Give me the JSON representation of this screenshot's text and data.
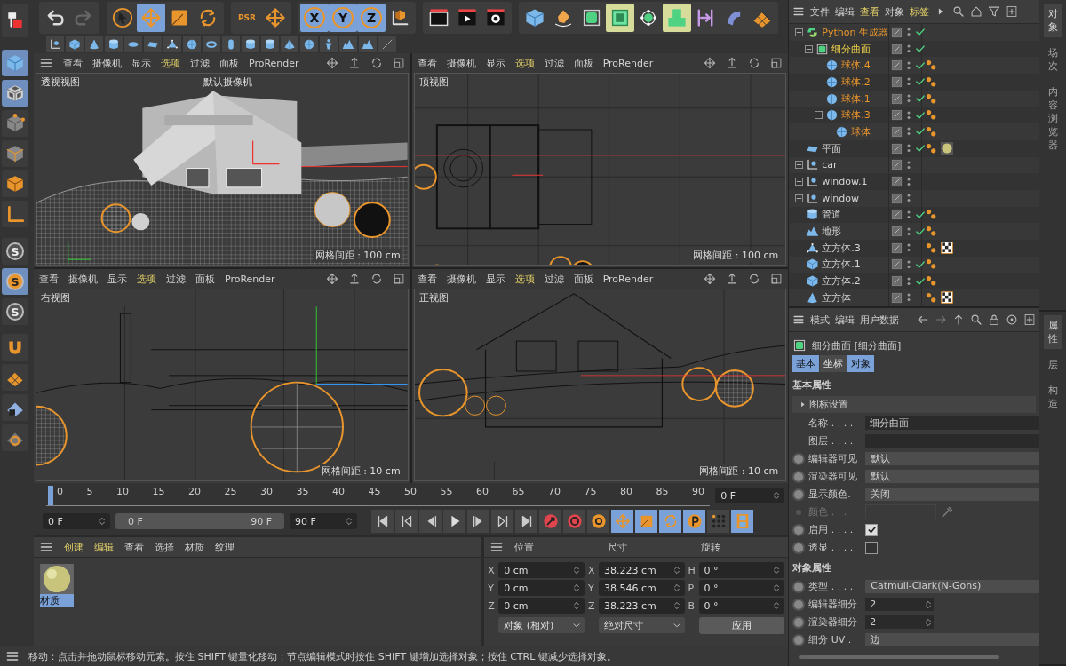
{
  "left_toolbar": [
    {
      "kind": "objects-mode",
      "selected": false
    },
    {
      "kind": "cube",
      "selected": true
    },
    {
      "kind": "checker-cube",
      "selected": true
    },
    {
      "kind": "point-cube",
      "selected": false
    },
    {
      "kind": "edge-cube",
      "selected": false
    },
    {
      "kind": "poly-cube",
      "selected": false
    },
    {
      "kind": "axis",
      "selected": false
    },
    {
      "kind": "letter",
      "label": "S",
      "selected": false
    },
    {
      "kind": "letter",
      "label": "S",
      "selected": true
    },
    {
      "kind": "letter",
      "label": "S",
      "selected": false
    },
    {
      "kind": "magnet",
      "selected": false
    },
    {
      "kind": "floor-grid",
      "selected": false
    },
    {
      "kind": "lock-grid",
      "selected": false
    },
    {
      "kind": "refresh-grid",
      "selected": false
    }
  ],
  "main_toolbar": [
    {
      "tools": [
        {
          "kind": "undo",
          "selected": false
        },
        {
          "kind": "redo",
          "selected": false
        }
      ]
    },
    {
      "tools": [
        {
          "kind": "select",
          "selected": false
        },
        {
          "kind": "move",
          "selected": true
        },
        {
          "kind": "scale",
          "selected": false
        },
        {
          "kind": "rotate",
          "selected": false
        }
      ]
    },
    {
      "tools": [
        {
          "kind": "psr",
          "label": "PSR",
          "selected": false
        },
        {
          "kind": "move",
          "selected": false
        }
      ]
    },
    {
      "tools": [
        {
          "kind": "axis-letter",
          "label": "X",
          "selected": true
        },
        {
          "kind": "axis-letter",
          "label": "Y",
          "selected": true
        },
        {
          "kind": "axis-letter",
          "label": "Z",
          "selected": true
        },
        {
          "kind": "coord",
          "selected": false
        }
      ]
    },
    {
      "tools": [
        {
          "kind": "clapper",
          "selected": false
        },
        {
          "kind": "render",
          "selected": false
        },
        {
          "kind": "render-settings",
          "selected": false
        }
      ]
    },
    {
      "tools": [
        {
          "kind": "cube",
          "selected": false
        },
        {
          "kind": "pen",
          "selected": false
        },
        {
          "kind": "subdiv",
          "selected": false
        },
        {
          "kind": "extrude",
          "selected": false
        },
        {
          "kind": "net",
          "selected": false
        },
        {
          "kind": "cubes",
          "selected": false
        },
        {
          "kind": "symmetry",
          "selected": false
        },
        {
          "kind": "bend",
          "selected": false
        },
        {
          "kind": "floor-grid",
          "selected": false
        }
      ]
    }
  ],
  "primitives": [
    {
      "kind": "null"
    },
    {
      "kind": "cube"
    },
    {
      "kind": "cone"
    },
    {
      "kind": "cylinder"
    },
    {
      "kind": "disc"
    },
    {
      "kind": "plane"
    },
    {
      "kind": "triangle"
    },
    {
      "kind": "sphere"
    },
    {
      "kind": "torus"
    },
    {
      "kind": "capsule"
    },
    {
      "kind": "cylinder"
    },
    {
      "kind": "cylinder"
    },
    {
      "kind": "pyramid"
    },
    {
      "kind": "sphere"
    },
    {
      "kind": "figure"
    },
    {
      "kind": "landscape"
    },
    {
      "kind": "landscape"
    },
    {
      "kind": "line"
    }
  ],
  "viewports": [
    {
      "kind": "perspective",
      "menu_icon": true,
      "label": "透视视图",
      "camera": "默认摄像机",
      "grid": "网格间距 : 100 cm",
      "menu": [
        {
          "text": "查看",
          "highlighted": false
        },
        {
          "text": "摄像机",
          "highlighted": false
        },
        {
          "text": "显示",
          "highlighted": false
        },
        {
          "text": "选项",
          "highlighted": true
        },
        {
          "text": "过滤",
          "highlighted": false
        },
        {
          "text": "面板",
          "highlighted": false
        },
        {
          "text": "ProRender",
          "highlighted": false
        }
      ]
    },
    {
      "kind": "top",
      "menu_icon": false,
      "label": "顶视图",
      "grid": "网格间距 : 100 cm",
      "menu": [
        {
          "text": "查看",
          "highlighted": false
        },
        {
          "text": "摄像机",
          "highlighted": false
        },
        {
          "text": "显示",
          "highlighted": false
        },
        {
          "text": "选项",
          "highlighted": true
        },
        {
          "text": "过滤",
          "highlighted": false
        },
        {
          "text": "面板",
          "highlighted": false
        },
        {
          "text": "ProRender",
          "highlighted": false
        }
      ]
    },
    {
      "kind": "right",
      "menu_icon": false,
      "label": "右视图",
      "grid": "网格间距 : 10 cm",
      "menu": [
        {
          "text": "查看",
          "highlighted": false
        },
        {
          "text": "摄像机",
          "highlighted": false
        },
        {
          "text": "显示",
          "highlighted": false
        },
        {
          "text": "选项",
          "highlighted": true
        },
        {
          "text": "过滤",
          "highlighted": false
        },
        {
          "text": "面板",
          "highlighted": false
        },
        {
          "text": "ProRender",
          "highlighted": false
        }
      ]
    },
    {
      "kind": "front",
      "menu_icon": false,
      "label": "正视图",
      "grid": "网格间距 : 10 cm",
      "menu": [
        {
          "text": "查看",
          "highlighted": false
        },
        {
          "text": "摄像机",
          "highlighted": false
        },
        {
          "text": "显示",
          "highlighted": false
        },
        {
          "text": "选项",
          "highlighted": true
        },
        {
          "text": "过滤",
          "highlighted": false
        },
        {
          "text": "面板",
          "highlighted": false
        },
        {
          "text": "ProRender",
          "highlighted": false
        }
      ]
    }
  ],
  "timeline": {
    "ticks": [
      "0",
      "5",
      "10",
      "15",
      "20",
      "25",
      "30",
      "35",
      "40",
      "45",
      "50",
      "55",
      "60",
      "65",
      "70",
      "75",
      "80",
      "85",
      "90"
    ],
    "level": 0,
    "current_frame": "0 F",
    "start": "0 F",
    "range_start": "0 F",
    "range_end": "90 F",
    "end": "90 F"
  },
  "transport": [
    {
      "kind": "go-start",
      "selected": false
    },
    {
      "kind": "prev-key",
      "selected": false
    },
    {
      "kind": "prev-frame",
      "selected": false
    },
    {
      "kind": "play",
      "selected": false
    },
    {
      "kind": "next-frame",
      "selected": false
    },
    {
      "kind": "next-key",
      "selected": false
    },
    {
      "kind": "go-end",
      "selected": false
    },
    {
      "kind": "record",
      "selected": false
    },
    {
      "kind": "autokey",
      "selected": false
    },
    {
      "kind": "keyframe-settings",
      "selected": false
    },
    {
      "kind": "move-key",
      "selected": true
    },
    {
      "kind": "scale-key",
      "selected": true
    },
    {
      "kind": "rotate-key",
      "selected": true
    },
    {
      "kind": "param-key",
      "selected": true
    },
    {
      "kind": "dots",
      "selected": false
    },
    {
      "kind": "film",
      "selected": true
    }
  ],
  "materials": {
    "menu": [
      {
        "text": "创建",
        "highlighted": true
      },
      {
        "text": "编辑",
        "highlighted": true
      },
      {
        "text": "查看",
        "highlighted": false
      },
      {
        "text": "选择",
        "highlighted": false
      },
      {
        "text": "材质",
        "highlighted": false
      },
      {
        "text": "纹理",
        "highlighted": false
      }
    ],
    "items": [
      {
        "name": "材质",
        "selected": true
      }
    ]
  },
  "coordinates": {
    "columns": [
      {
        "title": "位置",
        "fields": [
          {
            "axis": "X",
            "value": "0 cm"
          },
          {
            "axis": "Y",
            "value": "0 cm"
          },
          {
            "axis": "Z",
            "value": "0 cm"
          }
        ]
      },
      {
        "title": "尺寸",
        "fields": [
          {
            "axis": "X",
            "value": "38.223 cm"
          },
          {
            "axis": "Y",
            "value": "38.546 cm"
          },
          {
            "axis": "Z",
            "value": "38.223 cm"
          }
        ]
      },
      {
        "title": "旋转",
        "fields": [
          {
            "axis": "H",
            "value": "0 °"
          },
          {
            "axis": "P",
            "value": "0 °"
          },
          {
            "axis": "B",
            "value": "0 °"
          }
        ]
      }
    ],
    "mode": "对象 (相对)",
    "size_mode": "绝对尺寸",
    "apply": "应用"
  },
  "status_bar": "移动：点击并拖动鼠标移动元素。按住 SHIFT 键量化移动；节点编辑模式时按住 SHIFT 键增加选择对象；按住 CTRL 键减少选择对象。",
  "objects": {
    "menu": [
      {
        "text": "文件",
        "highlighted": false
      },
      {
        "text": "编辑",
        "highlighted": false
      },
      {
        "text": "查看",
        "highlighted": true
      },
      {
        "text": "对象",
        "highlighted": false
      },
      {
        "text": "标签",
        "highlighted": true
      }
    ],
    "items": [
      {
        "name": "Python 生成器",
        "kind": "python",
        "selected": true,
        "active": false,
        "check": true,
        "expanded": true,
        "children": [
          {
            "name": "细分曲面",
            "kind": "subdiv",
            "selected": false,
            "active": true,
            "check": true,
            "expanded": true,
            "children": [
              {
                "name": "球体.4",
                "kind": "sphere",
                "selected": true,
                "active": false,
                "check": true,
                "tags": [
                  {
                    "kind": "phong"
                  }
                ]
              },
              {
                "name": "球体.2",
                "kind": "sphere",
                "selected": true,
                "active": false,
                "check": true,
                "tags": [
                  {
                    "kind": "phong"
                  }
                ]
              },
              {
                "name": "球体.1",
                "kind": "sphere",
                "selected": true,
                "active": false,
                "check": true,
                "tags": [
                  {
                    "kind": "phong"
                  }
                ]
              },
              {
                "name": "球体.3",
                "kind": "sphere",
                "selected": true,
                "active": false,
                "check": true,
                "expanded": true,
                "tags": [
                  {
                    "kind": "phong"
                  }
                ],
                "children": [
                  {
                    "name": "球体",
                    "kind": "sphere",
                    "selected": true,
                    "active": false,
                    "check": true,
                    "tags": [
                      {
                        "kind": "phong"
                      }
                    ]
                  }
                ]
              }
            ]
          }
        ]
      },
      {
        "name": "平面",
        "kind": "plane",
        "selected": false,
        "active": false,
        "check": true,
        "tags": [
          {
            "kind": "phong"
          },
          {
            "kind": "material"
          }
        ]
      },
      {
        "name": "car",
        "kind": "null",
        "selected": false,
        "active": false,
        "check": false,
        "expanded": false
      },
      {
        "name": "window.1",
        "kind": "null",
        "selected": false,
        "active": false,
        "check": false,
        "expanded": false
      },
      {
        "name": "window",
        "kind": "null",
        "selected": false,
        "active": false,
        "check": false,
        "expanded": false
      },
      {
        "name": "管道",
        "kind": "cylinder",
        "selected": false,
        "active": false,
        "check": true,
        "tags": [
          {
            "kind": "phong"
          }
        ]
      },
      {
        "name": "地形",
        "kind": "landscape",
        "selected": false,
        "active": false,
        "check": true,
        "tags": [
          {
            "kind": "phong"
          }
        ]
      },
      {
        "name": "立方体.3",
        "kind": "triangle",
        "selected": false,
        "active": false,
        "check": false,
        "tags": [
          {
            "kind": "phong"
          },
          {
            "kind": "checker"
          }
        ]
      },
      {
        "name": "立方体.1",
        "kind": "cube",
        "selected": false,
        "active": false,
        "check": true,
        "tags": [
          {
            "kind": "phong"
          }
        ]
      },
      {
        "name": "立方体.2",
        "kind": "cube",
        "selected": false,
        "active": false,
        "check": true,
        "tags": [
          {
            "kind": "phong"
          }
        ]
      },
      {
        "name": "立方体",
        "kind": "cone",
        "selected": false,
        "active": false,
        "check": false,
        "tags": [
          {
            "kind": "phong"
          },
          {
            "kind": "checker"
          }
        ]
      }
    ]
  },
  "object_tabs": [
    {
      "text": "对象",
      "selected": true
    },
    {
      "text": "场次",
      "selected": false
    },
    {
      "text": "内容浏览器",
      "selected": false
    }
  ],
  "attributes": {
    "menu": [
      {
        "text": "模式",
        "highlighted": false
      },
      {
        "text": "编辑",
        "highlighted": false
      },
      {
        "text": "用户数据",
        "highlighted": false
      }
    ],
    "title": "细分曲面 [细分曲面]",
    "tabs": [
      {
        "text": "基本",
        "selected": true
      },
      {
        "text": "坐标",
        "selected": false
      },
      {
        "text": "对象",
        "selected": true
      }
    ],
    "sections": [
      {
        "title": "基本属性",
        "rows": [
          {
            "kind": "group",
            "label": "图标设置",
            "expanded": false
          },
          {
            "kind": "field",
            "label": "名称 . . . .",
            "value": "细分曲面",
            "animatable": false
          },
          {
            "kind": "field",
            "label": "图层 . . . .",
            "animatable": false
          },
          {
            "kind": "dropdown",
            "label": "编辑器可见",
            "value": "默认",
            "animatable": true
          },
          {
            "kind": "dropdown",
            "label": "渲染器可见",
            "value": "默认",
            "animatable": true
          },
          {
            "kind": "dropdown",
            "label": "显示颜色.",
            "value": "关闭",
            "animatable": true
          },
          {
            "kind": "color",
            "label": "颜色 . . .",
            "disabled": true,
            "animatable": true
          },
          {
            "kind": "checkbox",
            "label": "启用 . . . .",
            "checked": true,
            "animatable": true
          },
          {
            "kind": "checkbox",
            "label": "透显 . . . .",
            "checked": false,
            "animatable": true
          }
        ]
      },
      {
        "title": "对象属性",
        "rows": [
          {
            "kind": "dropdown",
            "label": "类型 . . . .",
            "value": "Catmull-Clark(N-Gons)",
            "animatable": true
          },
          {
            "kind": "spinner",
            "label": "编辑器细分",
            "value": "2",
            "animatable": true
          },
          {
            "kind": "spinner",
            "label": "渲染器细分",
            "value": "2",
            "animatable": true
          },
          {
            "kind": "dropdown",
            "label": "细分 UV .",
            "value": "边",
            "animatable": true
          }
        ]
      }
    ]
  },
  "attribute_tabs": [
    {
      "text": "属性",
      "selected": true
    },
    {
      "text": "层",
      "selected": false
    },
    {
      "text": "构造",
      "selected": false
    }
  ]
}
